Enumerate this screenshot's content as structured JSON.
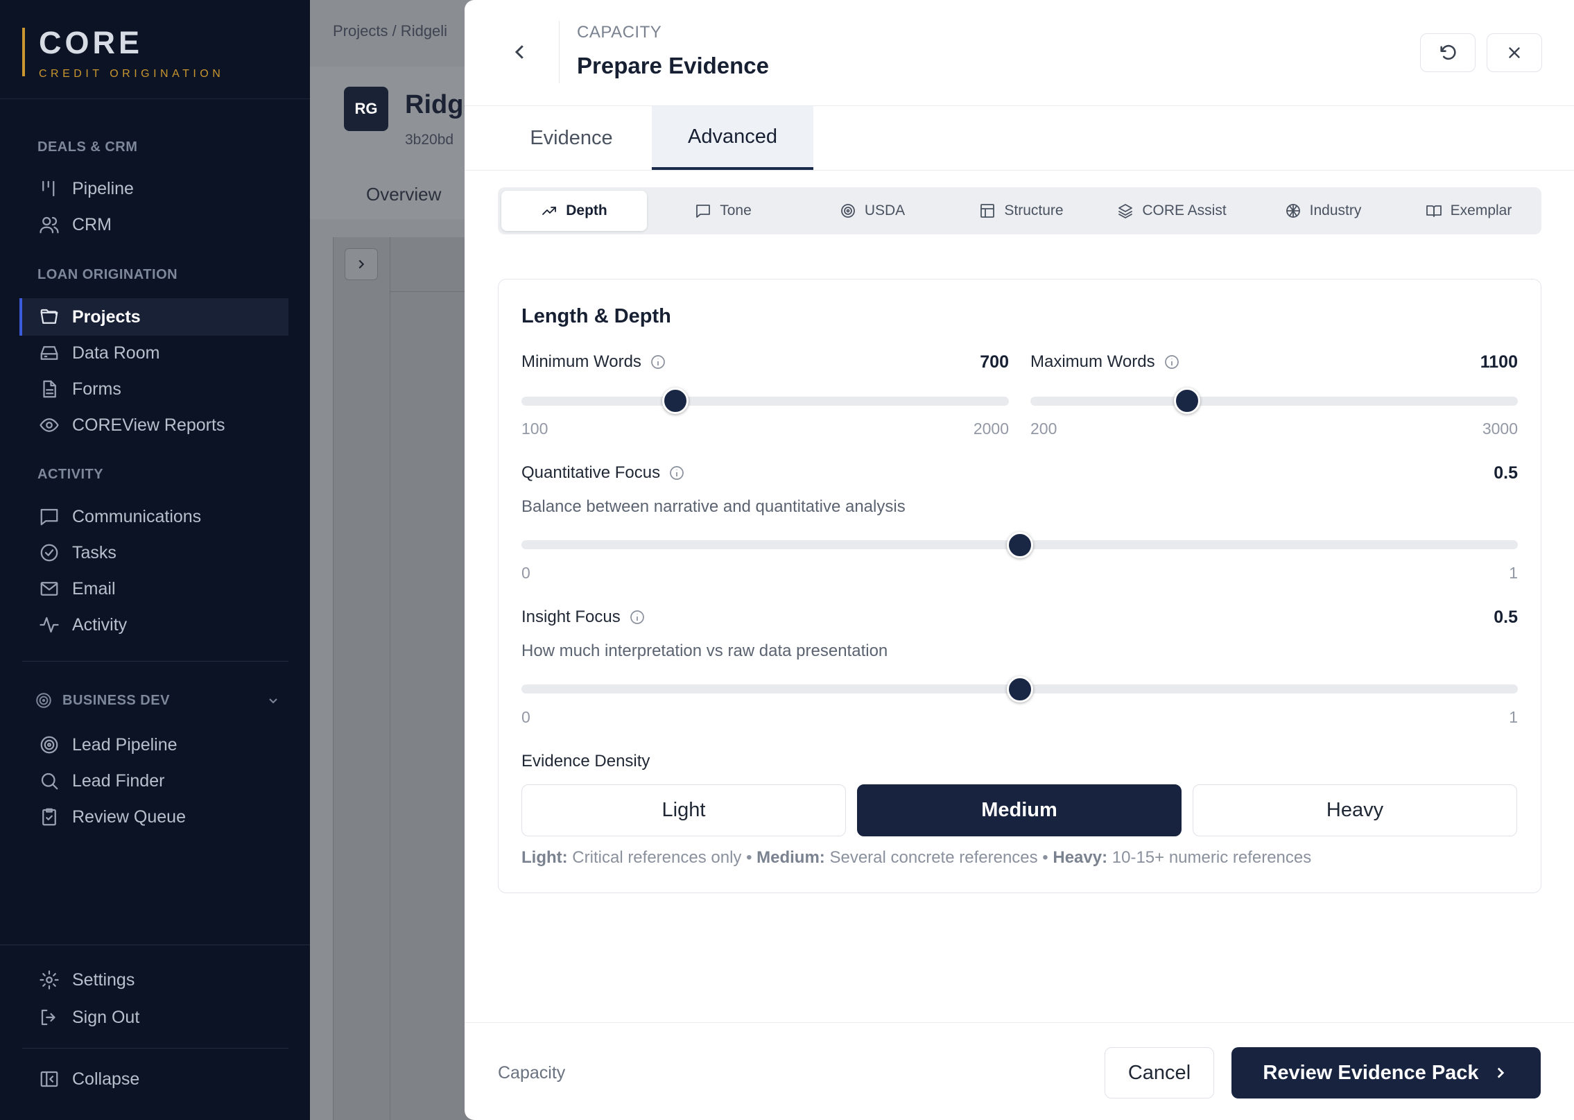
{
  "sidebar": {
    "brand_title": "CORE",
    "brand_subtitle": "CREDIT ORIGINATION",
    "sections": {
      "deals": "DEALS & CRM",
      "loan": "LOAN ORIGINATION",
      "activity": "ACTIVITY",
      "business": "BUSINESS DEV"
    },
    "items": {
      "pipeline": "Pipeline",
      "crm": "CRM",
      "projects": "Projects",
      "data_room": "Data Room",
      "forms": "Forms",
      "coreview": "COREView Reports",
      "communications": "Communications",
      "tasks": "Tasks",
      "email": "Email",
      "activity": "Activity",
      "lead_pipeline": "Lead Pipeline",
      "lead_finder": "Lead Finder",
      "review_queue": "Review Queue",
      "settings": "Settings",
      "sign_out": "Sign Out",
      "collapse": "Collapse"
    }
  },
  "background": {
    "breadcrumb": "Projects  /  Ridgeli",
    "avatar": "RG",
    "title": "Ridge",
    "id": "3b20bd",
    "tab": "Overview"
  },
  "modal": {
    "eyebrow": "CAPACITY",
    "title": "Prepare Evidence",
    "tabs": [
      "Evidence",
      "Advanced"
    ],
    "subtabs": [
      "Depth",
      "Tone",
      "USDA",
      "Structure",
      "CORE Assist",
      "Industry",
      "Exemplar"
    ],
    "card": {
      "title": "Length & Depth",
      "min_words": {
        "label": "Minimum Words",
        "value": "700",
        "min": "100",
        "max": "2000",
        "fraction": 0.316
      },
      "max_words": {
        "label": "Maximum Words",
        "value": "1100",
        "min": "200",
        "max": "3000",
        "fraction": 0.321
      },
      "quant": {
        "label": "Quantitative Focus",
        "value": "0.5",
        "desc": "Balance between narrative and quantitative analysis",
        "min": "0",
        "max": "1",
        "fraction": 0.5
      },
      "insight": {
        "label": "Insight Focus",
        "value": "0.5",
        "desc": "How much interpretation vs raw data presentation",
        "min": "0",
        "max": "1",
        "fraction": 0.5
      },
      "density": {
        "label": "Evidence Density",
        "options": [
          "Light",
          "Medium",
          "Heavy"
        ],
        "selected": "Medium",
        "legend": {
          "light_key": "Light:",
          "light_text": " Critical references only • ",
          "medium_key": "Medium:",
          "medium_text": " Several concrete references • ",
          "heavy_key": "Heavy:",
          "heavy_text": " 10-15+ numeric references"
        }
      }
    },
    "footer": {
      "label": "Capacity",
      "cancel": "Cancel",
      "primary": "Review Evidence Pack"
    }
  },
  "colors": {
    "accent_gold": "#c9962f",
    "primary_navy": "#182340",
    "sidebar_bg": "#0c1324"
  }
}
